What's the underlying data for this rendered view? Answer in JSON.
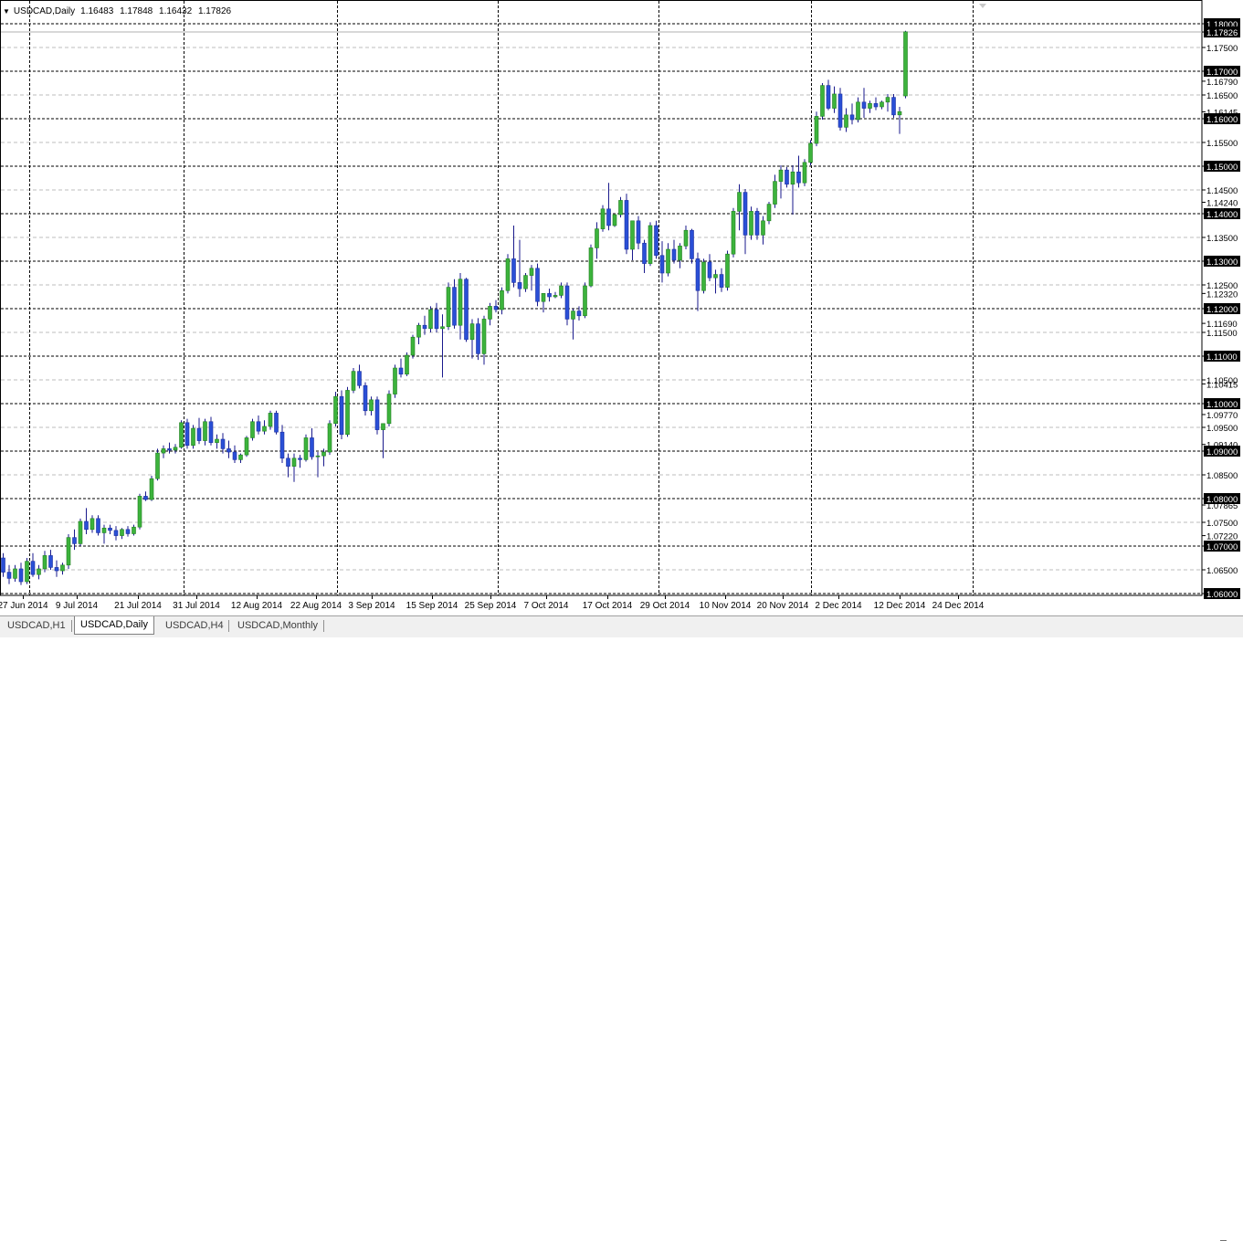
{
  "window": {
    "symbol_label": "USDCAD,Daily",
    "ohlc": [
      "1.16483",
      "1.17848",
      "1.16432",
      "1.17826"
    ],
    "menu_arrow": "▼"
  },
  "tabs": [
    {
      "label": "USDCAD,H1",
      "active": false
    },
    {
      "label": "USDCAD,Daily",
      "active": true
    },
    {
      "label": "USDCAD,H4",
      "active": false
    },
    {
      "label": "USDCAD,Monthly",
      "active": false
    }
  ],
  "colors": {
    "background": "#ffffff",
    "grid": "#000000",
    "bull_candle": "#3cb33c",
    "bear_candle": "#2a4fd6",
    "wick": "#1a1a8c",
    "price_tag_bg": "#000000",
    "price_tag_text": "#ffffff"
  },
  "chart_data": {
    "type": "candlestick",
    "y_axis_labels": [
      "1.18000",
      "1.17826",
      "1.17500",
      "1.17000",
      "1.16790",
      "1.16500",
      "1.16145",
      "1.16000",
      "1.15500",
      "1.15000",
      "1.14500",
      "1.14240",
      "1.14000",
      "1.13500",
      "1.13000",
      "1.12500",
      "1.12320",
      "1.12000",
      "1.11690",
      "1.11500",
      "1.11000",
      "1.10500",
      "1.10415",
      "1.10000",
      "1.09770",
      "1.09500",
      "1.09140",
      "1.09000",
      "1.08500",
      "1.08000",
      "1.07865",
      "1.07500",
      "1.07220",
      "1.07000",
      "1.06500",
      "1.06000"
    ],
    "x_axis_labels": [
      "27 Jun 2014",
      "9 Jul 2014",
      "21 Jul 2014",
      "31 Jul 2014",
      "12 Aug 2014",
      "22 Aug 2014",
      "3 Sep 2014",
      "15 Sep 2014",
      "25 Sep 2014",
      "7 Oct 2014",
      "17 Oct 2014",
      "29 Oct 2014",
      "10 Nov 2014",
      "20 Nov 2014",
      "2 Dec 2014",
      "12 Dec 2014",
      "24 Dec 2014"
    ],
    "ylim": [
      1.06,
      1.18
    ],
    "current_price": "1.17826",
    "grid": true,
    "ohlc": [
      [
        1.0675,
        1.0685,
        1.0635,
        1.0645
      ],
      [
        1.0645,
        1.066,
        1.062,
        1.0632
      ],
      [
        1.0632,
        1.066,
        1.0625,
        1.0652
      ],
      [
        1.0652,
        1.0665,
        1.0618,
        1.0625
      ],
      [
        1.0625,
        1.0675,
        1.062,
        1.0668
      ],
      [
        1.0668,
        1.0685,
        1.0635,
        1.064
      ],
      [
        1.064,
        1.066,
        1.063,
        1.0652
      ],
      [
        1.0652,
        1.069,
        1.0645,
        1.068
      ],
      [
        1.068,
        1.0692,
        1.065,
        1.0655
      ],
      [
        1.0655,
        1.067,
        1.0635,
        1.0648
      ],
      [
        1.0648,
        1.0665,
        1.064,
        1.066
      ],
      [
        1.066,
        1.0725,
        1.0652,
        1.0718
      ],
      [
        1.0718,
        1.0735,
        1.0692,
        1.0705
      ],
      [
        1.0705,
        1.0758,
        1.07,
        1.0752
      ],
      [
        1.0752,
        1.078,
        1.0725,
        1.0735
      ],
      [
        1.0735,
        1.0765,
        1.0728,
        1.0758
      ],
      [
        1.0758,
        1.0765,
        1.0722,
        1.0728
      ],
      [
        1.0728,
        1.0745,
        1.0705,
        1.0738
      ],
      [
        1.0738,
        1.0745,
        1.0725,
        1.0733
      ],
      [
        1.0733,
        1.0742,
        1.0712,
        1.0722
      ],
      [
        1.0722,
        1.0738,
        1.0715,
        1.0735
      ],
      [
        1.0735,
        1.0742,
        1.072,
        1.0726
      ],
      [
        1.0726,
        1.0745,
        1.0722,
        1.074
      ],
      [
        1.074,
        1.081,
        1.0735,
        1.0805
      ],
      [
        1.0805,
        1.0815,
        1.0795,
        1.0798
      ],
      [
        1.0798,
        1.0848,
        1.0795,
        1.0842
      ],
      [
        1.0842,
        1.0905,
        1.0838,
        1.0896
      ],
      [
        1.0896,
        1.0912,
        1.0885,
        1.0905
      ],
      [
        1.0905,
        1.0918,
        1.0895,
        1.0902
      ],
      [
        1.0902,
        1.0915,
        1.0895,
        1.0908
      ],
      [
        1.0908,
        1.0965,
        1.0905,
        1.096
      ],
      [
        1.096,
        1.0968,
        1.0905,
        1.0912
      ],
      [
        1.0912,
        1.0955,
        1.0905,
        1.0948
      ],
      [
        1.0948,
        1.097,
        1.0915,
        1.0922
      ],
      [
        1.0922,
        1.0968,
        1.0912,
        1.0962
      ],
      [
        1.0962,
        1.0972,
        1.0912,
        1.0918
      ],
      [
        1.0918,
        1.0935,
        1.0905,
        1.0925
      ],
      [
        1.0925,
        1.0938,
        1.0895,
        1.0905
      ],
      [
        1.0905,
        1.0922,
        1.0885,
        1.0898
      ],
      [
        1.0898,
        1.0912,
        1.0875,
        1.0882
      ],
      [
        1.0882,
        1.0895,
        1.0875,
        1.0892
      ],
      [
        1.0892,
        1.0932,
        1.0888,
        1.0928
      ],
      [
        1.0928,
        1.0968,
        1.0922,
        1.0962
      ],
      [
        1.0962,
        1.0975,
        1.0935,
        1.0942
      ],
      [
        1.0942,
        1.0965,
        1.0935,
        1.0952
      ],
      [
        1.0952,
        1.0985,
        1.0945,
        1.098
      ],
      [
        1.098,
        1.0985,
        1.0935,
        1.094
      ],
      [
        1.094,
        1.0955,
        1.0875,
        1.0885
      ],
      [
        1.0885,
        1.0895,
        1.0845,
        1.0868
      ],
      [
        1.0868,
        1.0895,
        1.0835,
        1.0885
      ],
      [
        1.0885,
        1.0892,
        1.0865,
        1.0882
      ],
      [
        1.0882,
        1.0935,
        1.0878,
        1.0928
      ],
      [
        1.0928,
        1.0948,
        1.0882,
        1.0888
      ],
      [
        1.0888,
        1.0898,
        1.0845,
        1.089
      ],
      [
        1.089,
        1.0905,
        1.0868,
        1.0898
      ],
      [
        1.0898,
        1.0965,
        1.0892,
        1.0958
      ],
      [
        1.0958,
        1.1025,
        1.0952,
        1.1015
      ],
      [
        1.1015,
        1.1028,
        1.0925,
        1.0935
      ],
      [
        1.0935,
        1.1035,
        1.093,
        1.1028
      ],
      [
        1.1028,
        1.1075,
        1.1022,
        1.1068
      ],
      [
        1.1068,
        1.1082,
        1.1032,
        1.1038
      ],
      [
        1.1038,
        1.1045,
        1.0975,
        1.0985
      ],
      [
        1.0985,
        1.1015,
        1.0975,
        1.1008
      ],
      [
        1.1008,
        1.1015,
        1.0935,
        1.0945
      ],
      [
        1.0945,
        1.0955,
        1.0885,
        1.0958
      ],
      [
        1.0958,
        1.1028,
        1.0952,
        1.102
      ],
      [
        1.102,
        1.1082,
        1.1012,
        1.1075
      ],
      [
        1.1075,
        1.1095,
        1.1055,
        1.1062
      ],
      [
        1.1062,
        1.1108,
        1.1058,
        1.1102
      ],
      [
        1.1102,
        1.1145,
        1.1095,
        1.114
      ],
      [
        1.114,
        1.117,
        1.1125,
        1.1165
      ],
      [
        1.1165,
        1.1185,
        1.1145,
        1.1158
      ],
      [
        1.1158,
        1.1205,
        1.115,
        1.1198
      ],
      [
        1.1198,
        1.1212,
        1.115,
        1.1158
      ],
      [
        1.1158,
        1.1188,
        1.1055,
        1.1162
      ],
      [
        1.1162,
        1.1255,
        1.1155,
        1.1245
      ],
      [
        1.1245,
        1.1262,
        1.1158,
        1.1165
      ],
      [
        1.1165,
        1.1275,
        1.1135,
        1.1262
      ],
      [
        1.1262,
        1.1265,
        1.113,
        1.1135
      ],
      [
        1.1135,
        1.1178,
        1.1095,
        1.1168
      ],
      [
        1.1168,
        1.118,
        1.1092,
        1.1105
      ],
      [
        1.1105,
        1.1185,
        1.1082,
        1.1178
      ],
      [
        1.1178,
        1.1212,
        1.1165,
        1.1205
      ],
      [
        1.1205,
        1.1218,
        1.1192,
        1.1198
      ],
      [
        1.1198,
        1.1245,
        1.1188,
        1.1238
      ],
      [
        1.1238,
        1.1315,
        1.1232,
        1.1305
      ],
      [
        1.1305,
        1.1375,
        1.1245,
        1.1255
      ],
      [
        1.1255,
        1.1345,
        1.1225,
        1.1242
      ],
      [
        1.1242,
        1.1275,
        1.1235,
        1.127
      ],
      [
        1.127,
        1.1292,
        1.1238,
        1.1285
      ],
      [
        1.1285,
        1.1295,
        1.1205,
        1.1215
      ],
      [
        1.1215,
        1.1232,
        1.1192,
        1.1232
      ],
      [
        1.1232,
        1.1242,
        1.1215,
        1.1225
      ],
      [
        1.1225,
        1.1235,
        1.1222,
        1.1228
      ],
      [
        1.1228,
        1.1255,
        1.1222,
        1.1248
      ],
      [
        1.1248,
        1.1255,
        1.1165,
        1.1178
      ],
      [
        1.1178,
        1.12,
        1.1135,
        1.1195
      ],
      [
        1.1195,
        1.1205,
        1.1175,
        1.1185
      ],
      [
        1.1185,
        1.1255,
        1.118,
        1.1248
      ],
      [
        1.1248,
        1.1335,
        1.1245,
        1.1328
      ],
      [
        1.1328,
        1.1382,
        1.1305,
        1.1368
      ],
      [
        1.1368,
        1.1418,
        1.1362,
        1.141
      ],
      [
        1.141,
        1.1465,
        1.1365,
        1.1375
      ],
      [
        1.1375,
        1.1398,
        1.1372,
        1.1398
      ],
      [
        1.1398,
        1.1435,
        1.1392,
        1.1428
      ],
      [
        1.1428,
        1.1442,
        1.1315,
        1.1325
      ],
      [
        1.1325,
        1.1355,
        1.1302,
        1.1385
      ],
      [
        1.1385,
        1.1395,
        1.1325,
        1.1338
      ],
      [
        1.1338,
        1.1345,
        1.1275,
        1.1295
      ],
      [
        1.1295,
        1.1382,
        1.129,
        1.1375
      ],
      [
        1.1375,
        1.1385,
        1.1305,
        1.1312
      ],
      [
        1.1312,
        1.1342,
        1.1255,
        1.1275
      ],
      [
        1.1275,
        1.1338,
        1.1268,
        1.1325
      ],
      [
        1.1325,
        1.1345,
        1.1295,
        1.1302
      ],
      [
        1.1302,
        1.1338,
        1.1285,
        1.1332
      ],
      [
        1.1332,
        1.1375,
        1.1325,
        1.1365
      ],
      [
        1.1365,
        1.1368,
        1.1295,
        1.1305
      ],
      [
        1.1305,
        1.1318,
        1.1195,
        1.1238
      ],
      [
        1.1238,
        1.1305,
        1.1232,
        1.1298
      ],
      [
        1.1298,
        1.1315,
        1.1258,
        1.1265
      ],
      [
        1.1265,
        1.1282,
        1.1232,
        1.1272
      ],
      [
        1.1272,
        1.1285,
        1.1235,
        1.1245
      ],
      [
        1.1245,
        1.1322,
        1.1238,
        1.1315
      ],
      [
        1.1315,
        1.1412,
        1.1308,
        1.1405
      ],
      [
        1.1405,
        1.1462,
        1.1365,
        1.1445
      ],
      [
        1.1445,
        1.1452,
        1.1315,
        1.1355
      ],
      [
        1.1355,
        1.1415,
        1.1345,
        1.1405
      ],
      [
        1.1405,
        1.1412,
        1.1345,
        1.1355
      ],
      [
        1.1355,
        1.1395,
        1.1335,
        1.1385
      ],
      [
        1.1385,
        1.1425,
        1.1378,
        1.142
      ],
      [
        1.142,
        1.1482,
        1.1412,
        1.1468
      ],
      [
        1.1468,
        1.1502,
        1.1432,
        1.1492
      ],
      [
        1.1492,
        1.1498,
        1.1455,
        1.1462
      ],
      [
        1.1462,
        1.1502,
        1.1398,
        1.1488
      ],
      [
        1.1488,
        1.1522,
        1.1455,
        1.1465
      ],
      [
        1.1465,
        1.1515,
        1.1458,
        1.1508
      ],
      [
        1.1508,
        1.1555,
        1.1502,
        1.1548
      ],
      [
        1.1548,
        1.1615,
        1.1542,
        1.1605
      ],
      [
        1.1605,
        1.1675,
        1.1598,
        1.167
      ],
      [
        1.167,
        1.1682,
        1.1618,
        1.1622
      ],
      [
        1.1622,
        1.1668,
        1.1612,
        1.1652
      ],
      [
        1.1652,
        1.1665,
        1.1575,
        1.1582
      ],
      [
        1.1582,
        1.1622,
        1.1572,
        1.1608
      ],
      [
        1.1608,
        1.1632,
        1.1588,
        1.1598
      ],
      [
        1.1598,
        1.1645,
        1.1592,
        1.1635
      ],
      [
        1.1635,
        1.1665,
        1.1602,
        1.1622
      ],
      [
        1.1622,
        1.1638,
        1.1612,
        1.1632
      ],
      [
        1.1632,
        1.1645,
        1.1618,
        1.1625
      ],
      [
        1.1625,
        1.1638,
        1.162,
        1.1635
      ],
      [
        1.1635,
        1.1652,
        1.1615,
        1.1645
      ],
      [
        1.1645,
        1.1652,
        1.1602,
        1.1608
      ],
      [
        1.1608,
        1.1625,
        1.1568,
        1.1615
      ],
      [
        1.1648,
        1.1785,
        1.1643,
        1.1783
      ]
    ]
  }
}
